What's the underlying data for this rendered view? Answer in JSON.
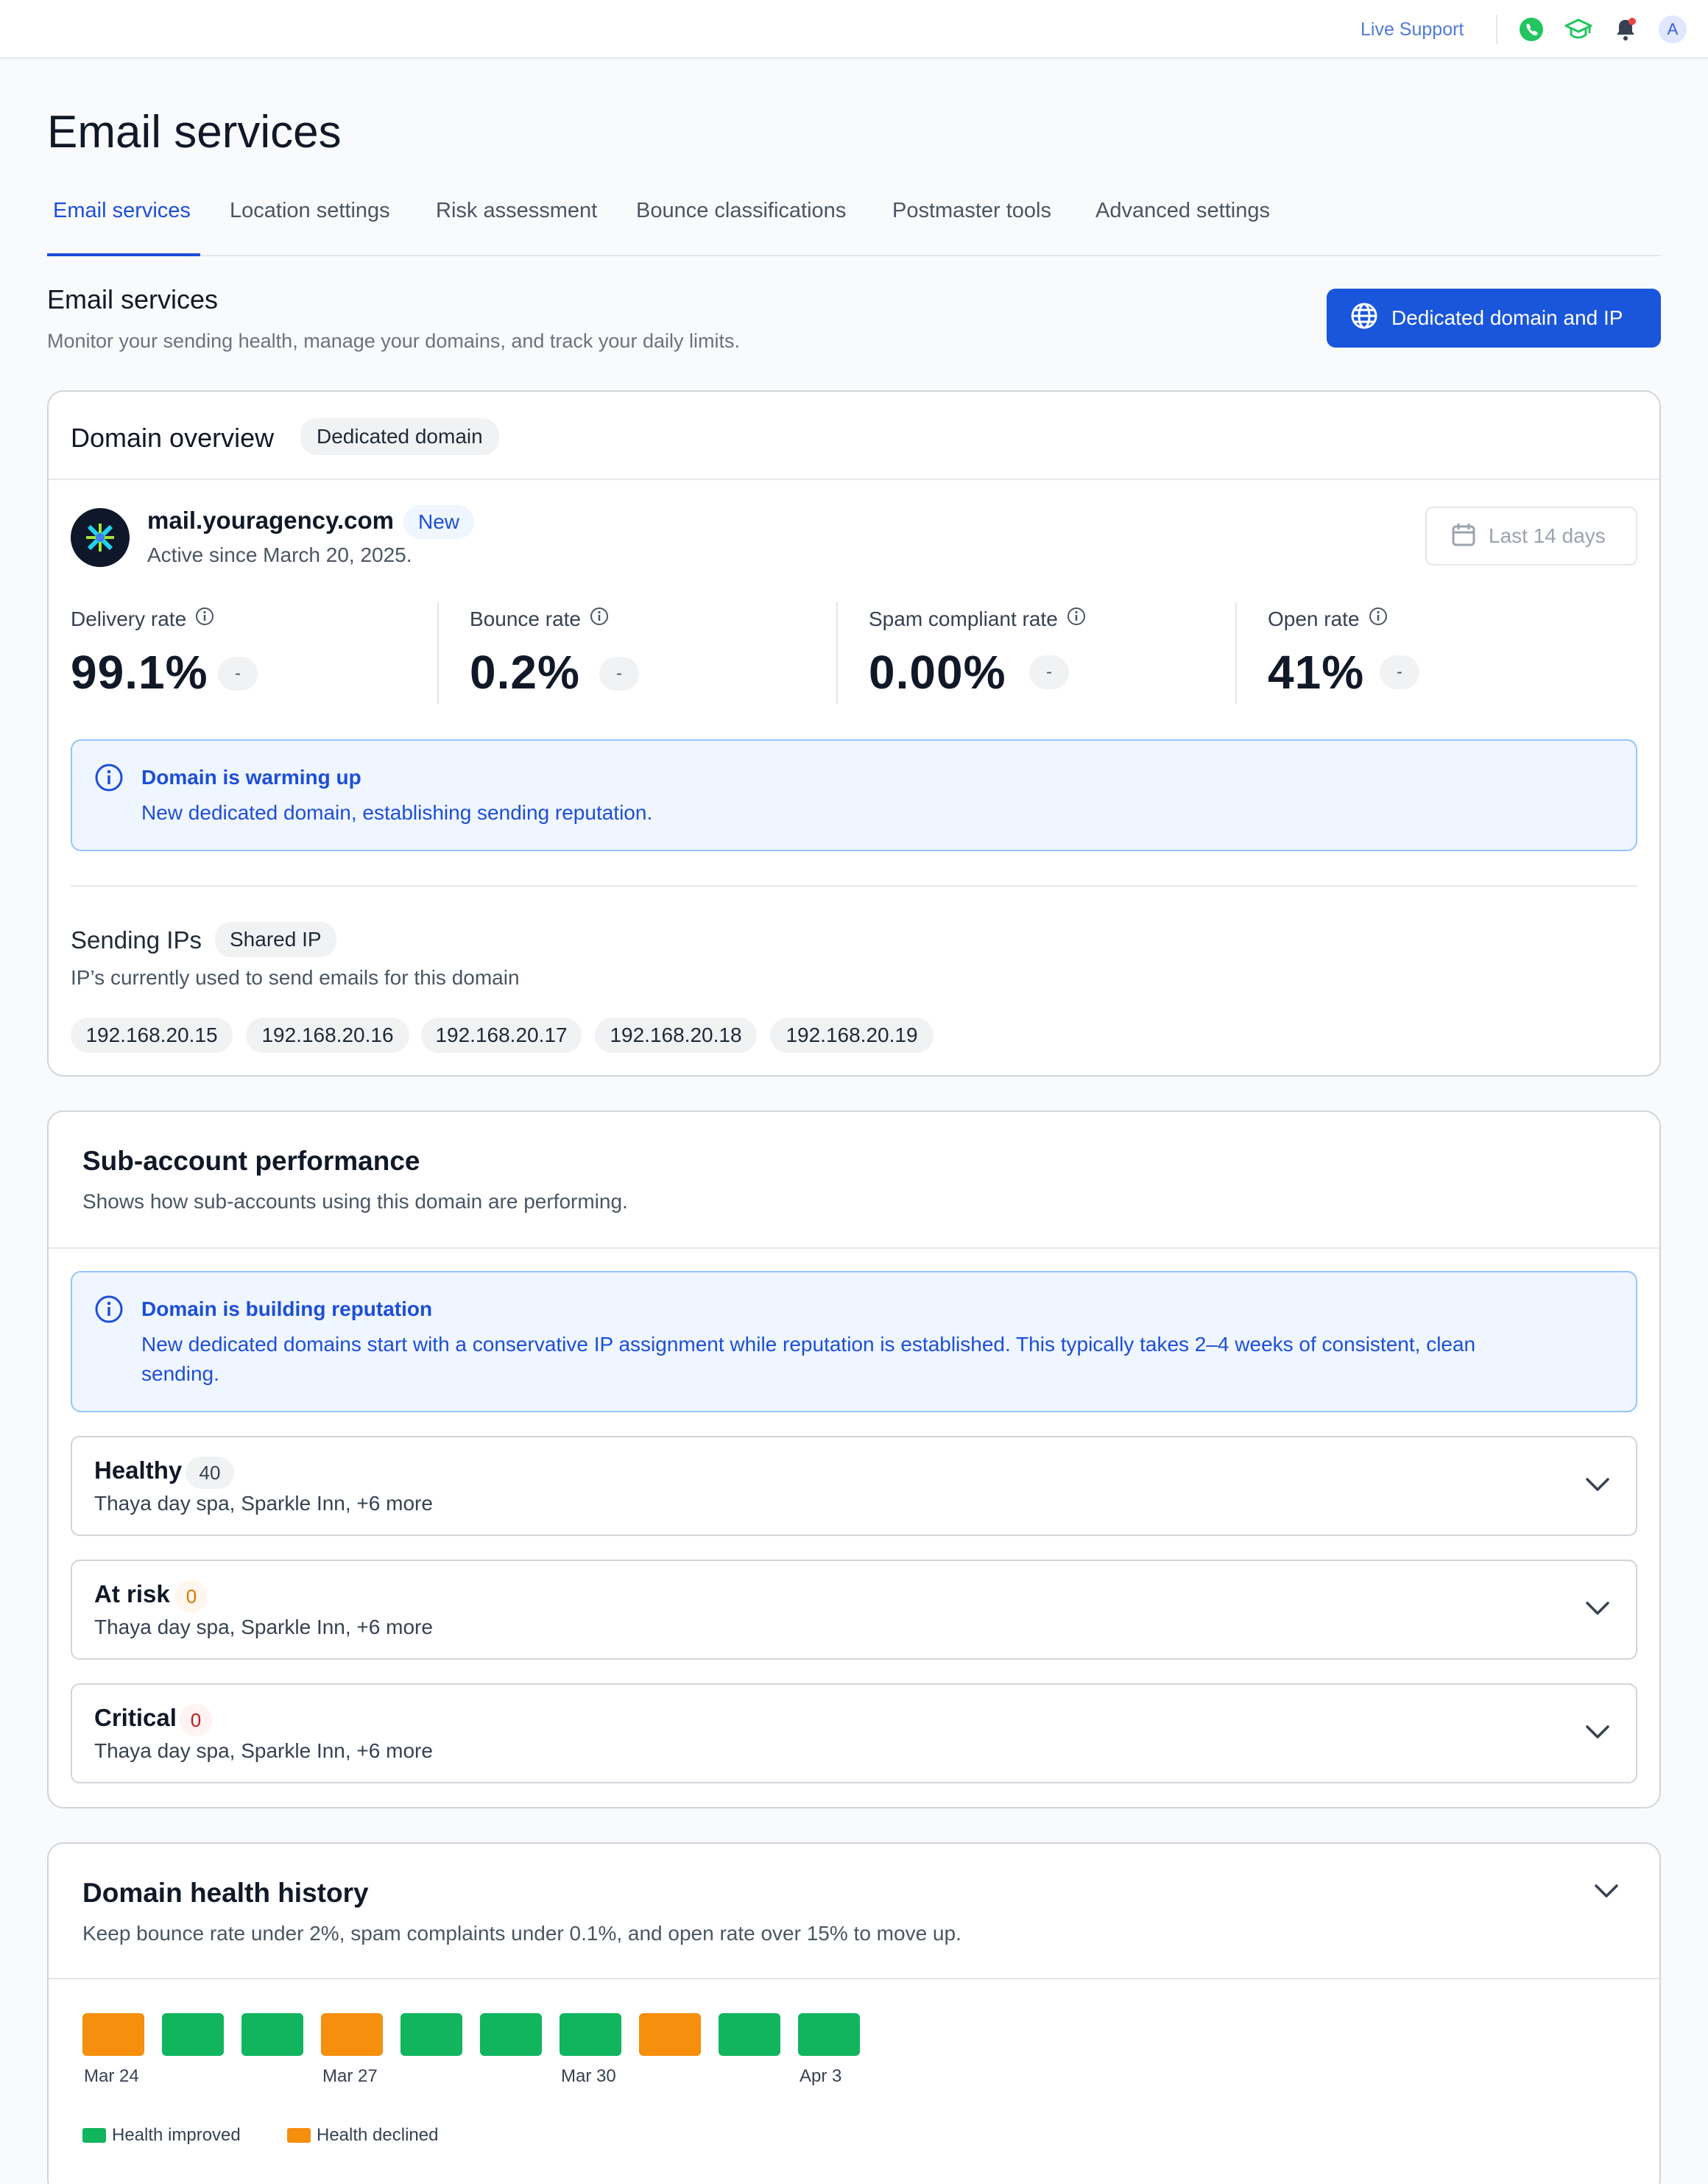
{
  "topbar": {
    "live_support": "Live Support",
    "avatar_initial": "A"
  },
  "page": {
    "title": "Email services"
  },
  "tabs": [
    {
      "label": "Email services",
      "active": true
    },
    {
      "label": "Location settings"
    },
    {
      "label": "Risk assessment"
    },
    {
      "label": "Bounce classifications"
    },
    {
      "label": "Postmaster tools"
    },
    {
      "label": "Advanced settings"
    }
  ],
  "section": {
    "title": "Email services",
    "subtitle": "Monitor your sending health, manage your domains, and track your daily limits.",
    "button": "Dedicated domain and IP"
  },
  "domain_overview": {
    "title": "Domain overview",
    "badge": "Dedicated domain",
    "domain": "mail.youragency.com",
    "domain_badge": "New",
    "active_since": "Active since March 20, 2025.",
    "date_range": "Last 14 days",
    "metrics": [
      {
        "label": "Delivery rate",
        "value": "99.1%",
        "change": "-"
      },
      {
        "label": "Bounce rate",
        "value": "0.2%",
        "change": "-"
      },
      {
        "label": "Spam compliant rate",
        "value": "0.00%",
        "change": "-"
      },
      {
        "label": "Open rate",
        "value": "41%",
        "change": "-"
      }
    ],
    "alert": {
      "title": "Domain is warming up",
      "text": "New dedicated domain, establishing sending reputation."
    },
    "sending_ips": {
      "title": "Sending IPs",
      "badge": "Shared IP",
      "subtitle": "IP’s currently used to send emails for this domain",
      "ips": [
        "192.168.20.15",
        "192.168.20.16",
        "192.168.20.17",
        "192.168.20.18",
        "192.168.20.19"
      ]
    }
  },
  "sub_account": {
    "title": "Sub-account performance",
    "subtitle": "Shows how sub-accounts using this domain are performing.",
    "alert": {
      "title": "Domain is building reputation",
      "text_line1": "New dedicated domains start with a conservative IP assignment while reputation is established. This typically takes 2–4 weeks of consistent, clean",
      "text_line2": "sending."
    },
    "groups": [
      {
        "label": "Healthy",
        "count": "40",
        "accounts": "Thaya day spa, Sparkle Inn, +6 more",
        "color": "#374151"
      },
      {
        "label": "At risk",
        "count": "0",
        "accounts": "Thaya day spa, Sparkle Inn, +6 more",
        "color": "#d97706"
      },
      {
        "label": "Critical",
        "count": "0",
        "accounts": "Thaya day spa, Sparkle Inn, +6 more",
        "color": "#b91c1c"
      }
    ]
  },
  "health_history": {
    "title": "Domain health history",
    "subtitle": "Keep bounce rate under 2%, spam complaints under 0.1%, and open rate over 15% to move up.",
    "days": [
      "declined",
      "improved",
      "improved",
      "declined",
      "improved",
      "improved",
      "improved",
      "declined",
      "improved",
      "improved"
    ],
    "date_labels": [
      {
        "label": "Mar 24",
        "index": 0
      },
      {
        "label": "Mar 27",
        "index": 3
      },
      {
        "label": "Mar 30",
        "index": 6
      },
      {
        "label": "Apr 3",
        "index": 9
      }
    ],
    "legend": [
      {
        "label": "Health improved",
        "color": "#10b55e"
      },
      {
        "label": "Health declined",
        "color": "#f58f0d"
      }
    ]
  }
}
